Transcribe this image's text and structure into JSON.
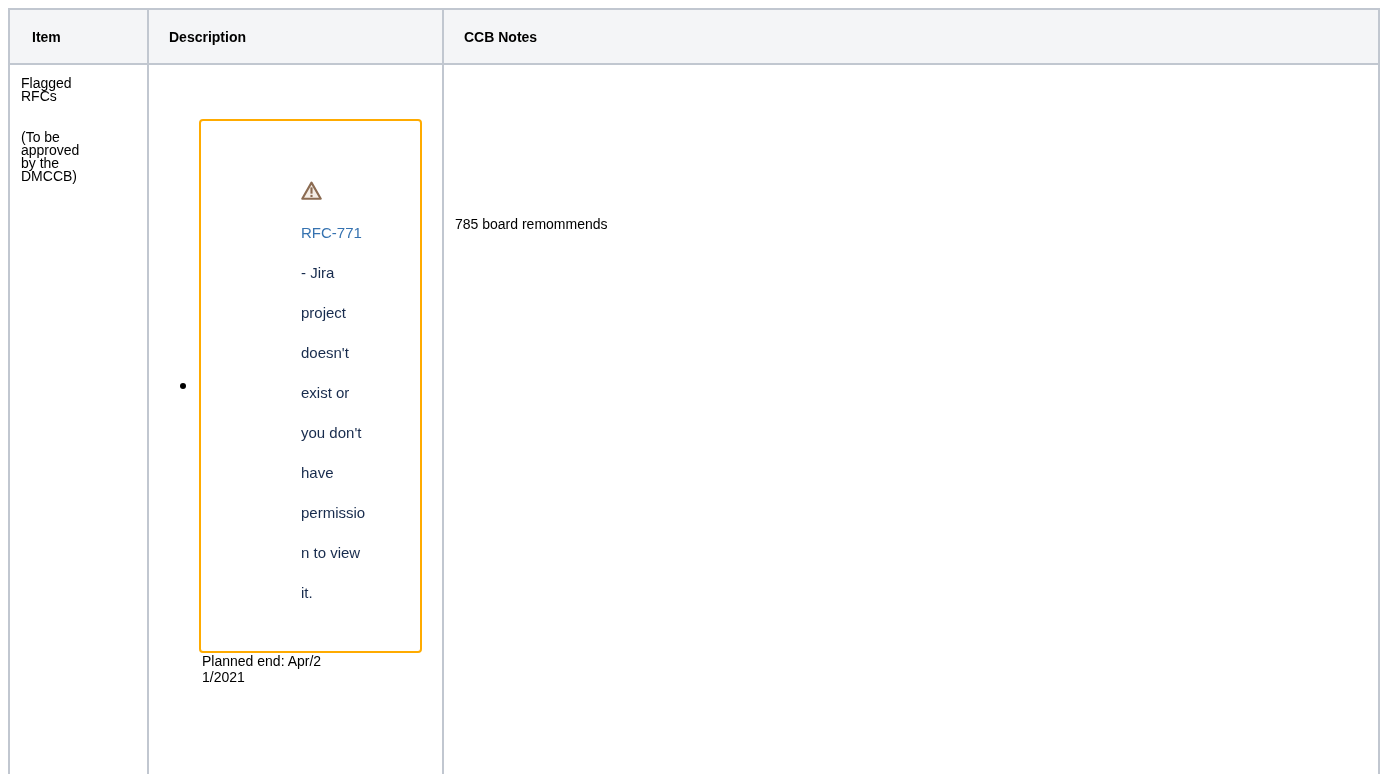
{
  "table": {
    "columns": [
      "Item",
      "Description",
      "CCB Notes"
    ],
    "rows": [
      {
        "item": [
          "Flagged RFCs",
          "(To be approved by the DMCCB)"
        ],
        "description": {
          "issues": [
            {
              "key": "RFC-771",
              "message": "- Jira project doesn't exist or you don't have permission to view it."
            }
          ],
          "planned_end": "Planned end: Apr/21/2021"
        },
        "notes": "785 board remommends"
      }
    ]
  }
}
